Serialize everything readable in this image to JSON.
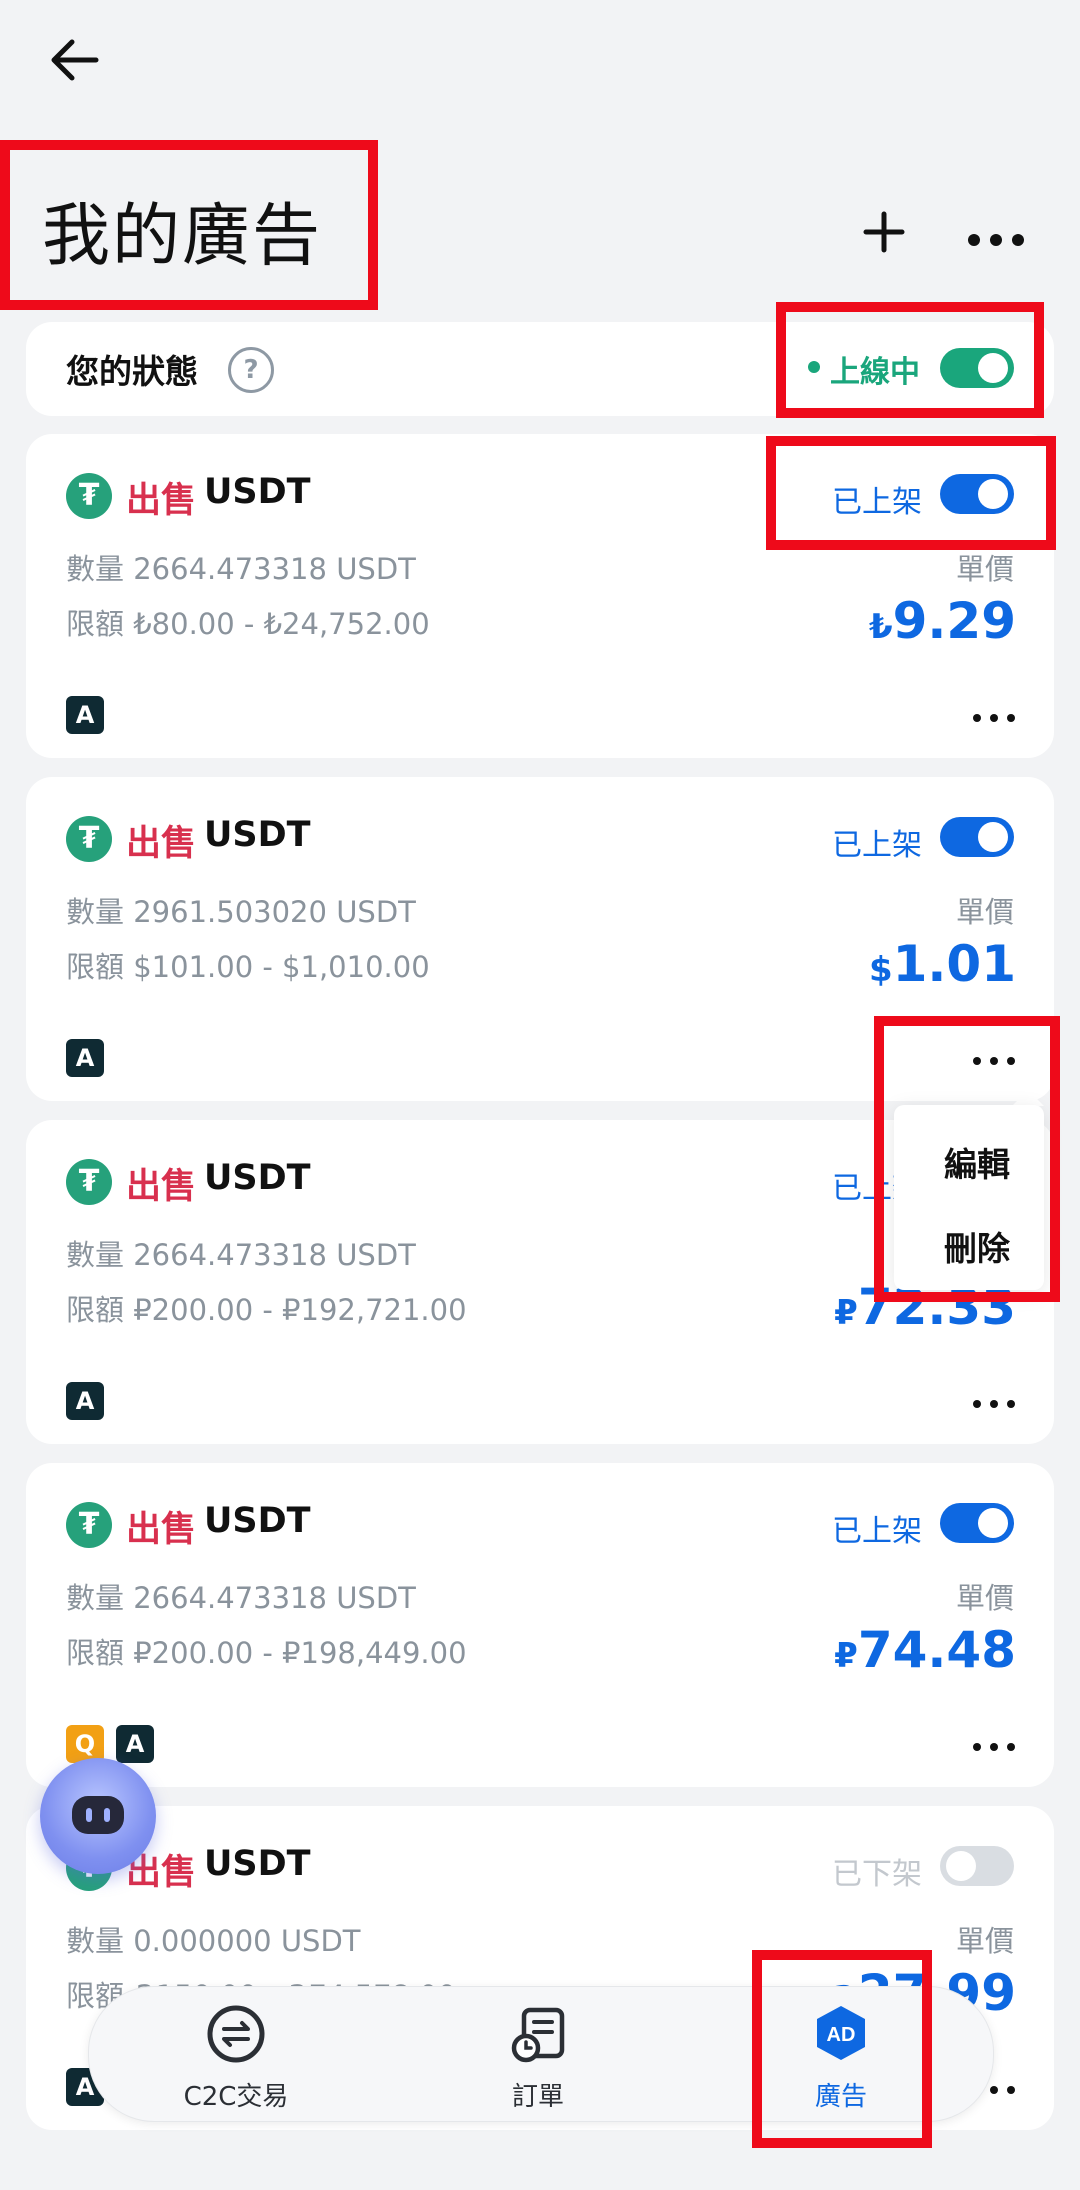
{
  "header": {
    "title": "我的廣告",
    "back_icon": "arrow-left-icon",
    "add_icon": "plus-icon",
    "more_icon": "more-horizontal-icon"
  },
  "status_bar": {
    "label": "您的狀態",
    "help_glyph": "?",
    "status_text": "上線中",
    "toggle_on": true
  },
  "ads": [
    {
      "side": "出售",
      "asset": "USDT",
      "status": "已上架",
      "listed": true,
      "qty_label": "數量",
      "qty": "2664.473318",
      "qty_unit": "USDT",
      "limit_label": "限額",
      "limit": "₺80.00 - ₺24,752.00",
      "unit_label": "單價",
      "currency": "₺",
      "price": "9.29",
      "payments": [
        "A"
      ]
    },
    {
      "side": "出售",
      "asset": "USDT",
      "status": "已上架",
      "listed": true,
      "qty_label": "數量",
      "qty": "2961.503020",
      "qty_unit": "USDT",
      "limit_label": "限額",
      "limit": "$101.00 - $1,010.00",
      "unit_label": "單價",
      "currency": "$",
      "price": "1.01",
      "payments": [
        "A"
      ]
    },
    {
      "side": "出售",
      "asset": "USDT",
      "status": "已上架",
      "listed": true,
      "qty_label": "數量",
      "qty": "2664.473318",
      "qty_unit": "USDT",
      "limit_label": "限額",
      "limit": "₽200.00 - ₽192,721.00",
      "unit_label": "單價",
      "currency": "₽",
      "price": "72.33",
      "payments": [
        "A"
      ]
    },
    {
      "side": "出售",
      "asset": "USDT",
      "status": "已上架",
      "listed": true,
      "qty_label": "數量",
      "qty": "2664.473318",
      "qty_unit": "USDT",
      "limit_label": "限額",
      "limit": "₽200.00 - ₽198,449.00",
      "unit_label": "單價",
      "currency": "₽",
      "price": "74.48",
      "payments": [
        "Q",
        "A"
      ]
    },
    {
      "side": "出售",
      "asset": "USDT",
      "status": "已下架",
      "listed": false,
      "qty_label": "數量",
      "qty": "0.000000",
      "qty_unit": "USDT",
      "limit_label": "限額",
      "limit": "₴150.00 - ₴74,578.00",
      "unit_label": "單價",
      "currency": "₴",
      "price": "27.99",
      "payments": [
        "A"
      ]
    }
  ],
  "popup_menu": {
    "edit": "編輯",
    "delete": "刪除"
  },
  "bottom_nav": [
    {
      "label": "C2C交易",
      "icon": "swap-circle-icon",
      "active": false
    },
    {
      "label": "訂單",
      "icon": "order-clock-icon",
      "active": false
    },
    {
      "label": "廣告",
      "icon": "ad-hexagon-icon",
      "active": true,
      "badge": "AD"
    }
  ],
  "colors": {
    "accent": "#0e68e1",
    "online": "#1aa67c",
    "sell": "#d8304e",
    "highlight": "#ee0a1a"
  }
}
